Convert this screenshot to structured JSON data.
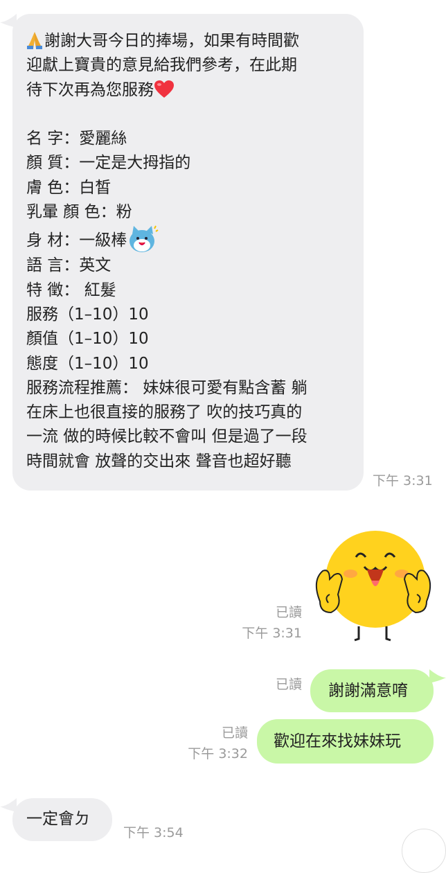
{
  "messages": {
    "incoming_1": {
      "lines": [
        "謝謝大哥今日的捧場，如果有時間歡",
        "迎獻上寶貴的意見給我們參考，在此期",
        "待下次再為您服務",
        "",
        "名 字：愛麗絲",
        "顏 質：一定是大拇指的",
        "膚 色：白皙",
        "乳暈 顏 色：粉",
        "身 材：一級棒",
        "語 言：英文",
        "特 徵： 紅髮",
        "服務（1–10）10",
        "顏值（1–10）10",
        "態度（1–10）10",
        "服務流程推薦： 妹妹很可愛有點含蓄 躺",
        "在床上也很直接的服務了 吹的技巧真的",
        "一流 做的時候比較不會叫 但是過了一段",
        "時間就會 放聲的交出來 聲音也超好聽"
      ],
      "time": "下午 3:31",
      "emojis": {
        "leading": "pray-emoji",
        "after_line3": "red-heart-emoji",
        "after_line9": "blue-cat-sticker-emoji"
      }
    },
    "sticker": {
      "name": "yellow-face-peace-sticker",
      "read": "已讀",
      "time": "下午 3:31"
    },
    "outgoing_1": {
      "text": "謝謝滿意唷",
      "read": "已讀"
    },
    "outgoing_2": {
      "text": "歡迎在來找妹妹玩",
      "read": "已讀",
      "time": "下午 3:32"
    },
    "incoming_2": {
      "text": "一定會ㄉ",
      "time": "下午 3:54"
    }
  },
  "colors": {
    "incoming_bubble": "#eeeef0",
    "outgoing_bubble": "#c9f7a7",
    "meta_text": "#9a9a9a"
  }
}
